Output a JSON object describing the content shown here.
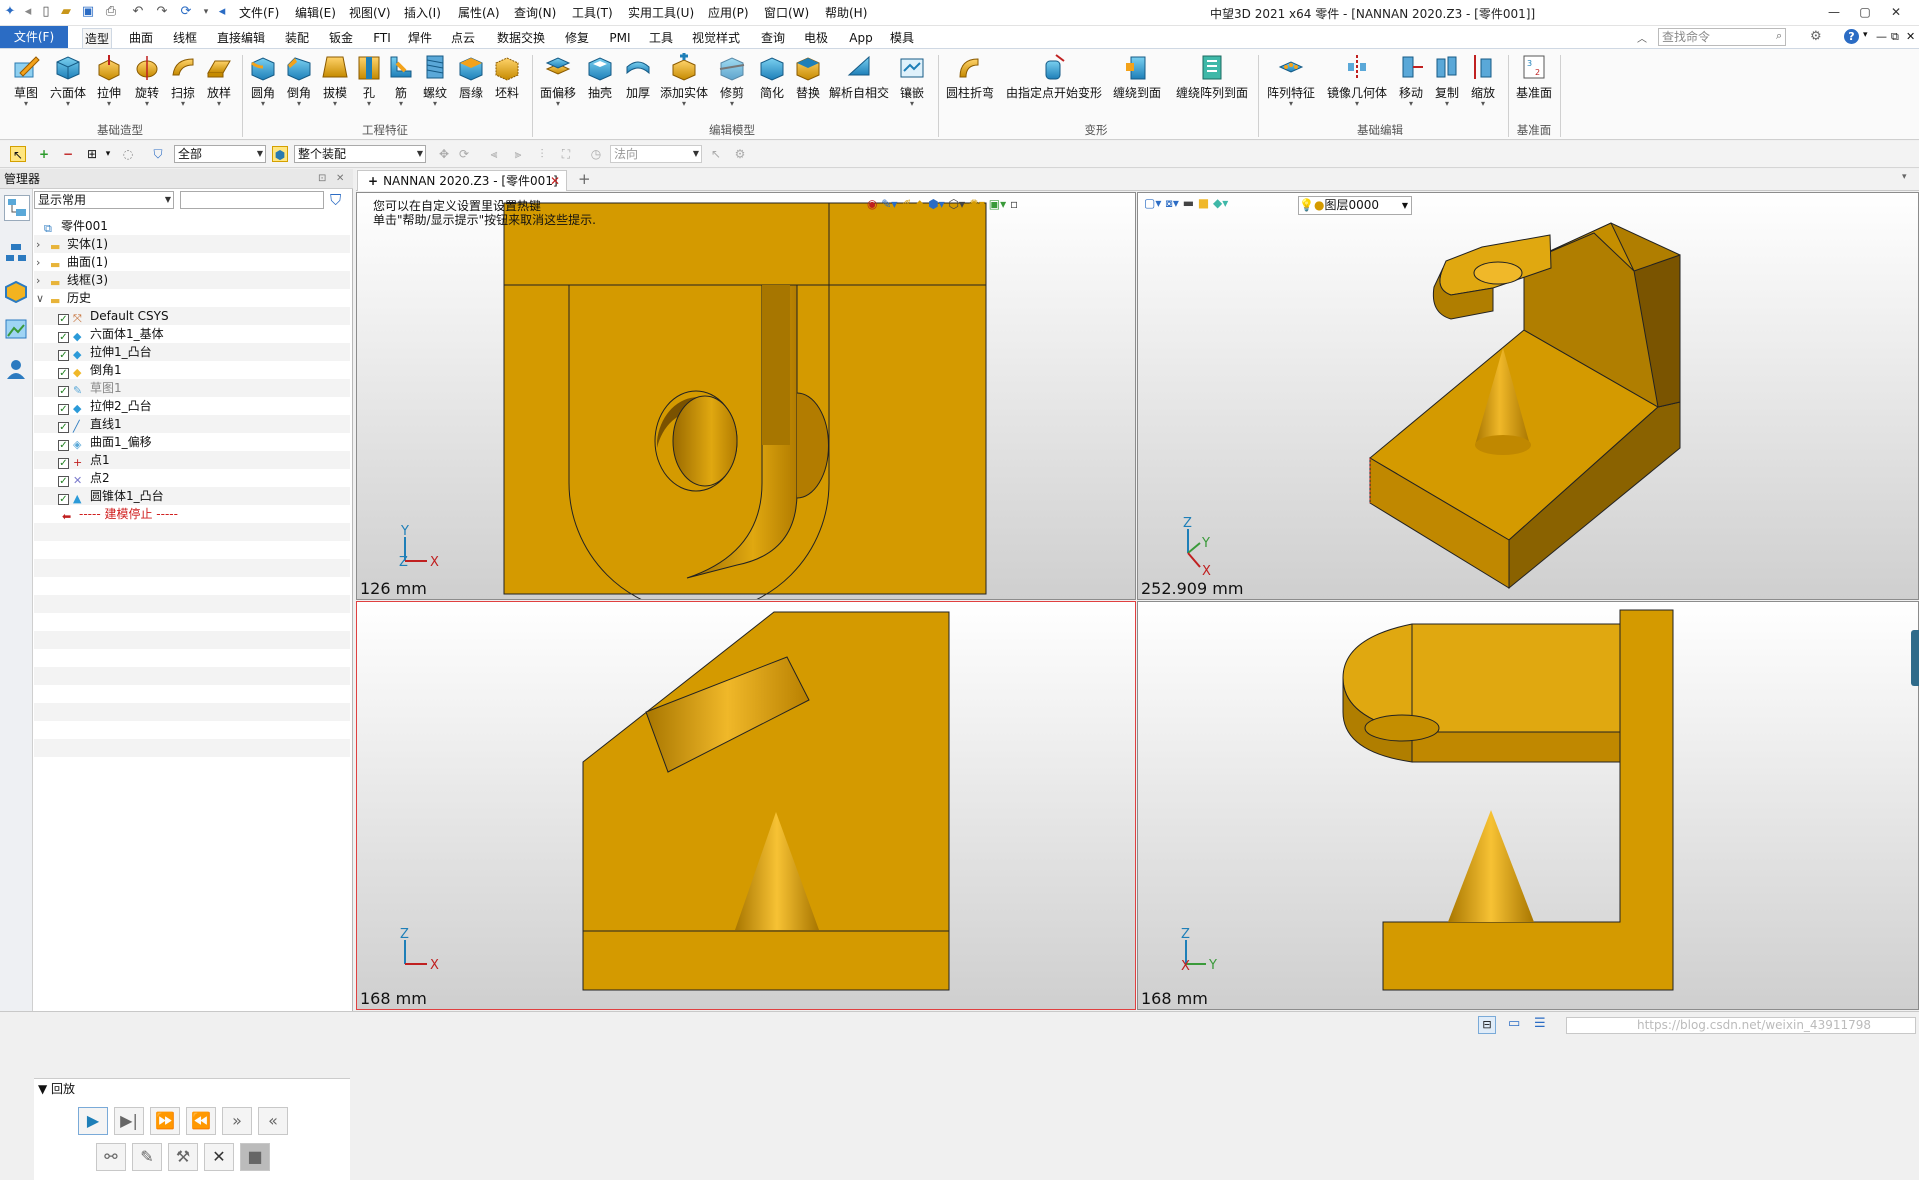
{
  "menus": [
    "文件(F)",
    "编辑(E)",
    "视图(V)",
    "插入(I)",
    "属性(A)",
    "查询(N)",
    "工具(T)",
    "实用工具(U)",
    "应用(P)",
    "窗口(W)",
    "帮助(H)"
  ],
  "window_title": "中望3D 2021 x64      零件 - [NANNAN 2020.Z3 - [零件001]]",
  "ribbon_tabs": [
    "文件(F)",
    "造型",
    "曲面",
    "线框",
    "直接编辑",
    "装配",
    "钣金",
    "FTI",
    "焊件",
    "点云",
    "数据交换",
    "修复",
    "PMI",
    "工具",
    "视觉样式",
    "查询",
    "电极",
    "App",
    "模具"
  ],
  "active_tab": "造型",
  "search_placeholder": "查找命令",
  "ribbon": {
    "groups": {
      "basic": "基础造型",
      "eng": "工程特征",
      "edit": "编辑模型",
      "deform": "变形",
      "basicedit": "基础编辑",
      "datum": "基准面"
    },
    "tools": [
      "草图",
      "六面体",
      "拉伸",
      "旋转",
      "扫掠",
      "放样",
      "圆角",
      "倒角",
      "拔模",
      "孔",
      "筋",
      "螺纹",
      "唇缘",
      "坯料",
      "面偏移",
      "抽壳",
      "加厚",
      "添加实体",
      "修剪",
      "简化",
      "替换",
      "解析自相交",
      "镶嵌",
      "圆柱折弯",
      "由指定点开始变形",
      "缠绕到面",
      "缠绕阵列到面",
      "阵列特征",
      "镜像几何体",
      "移动",
      "复制",
      "缩放",
      "基准面"
    ]
  },
  "toolbar2": {
    "filter_value": "全部",
    "assembly_value": "整个装配",
    "normal_value": "法向"
  },
  "manager": {
    "title": "管理器",
    "display_value": "显示常用",
    "tree": [
      {
        "label": "零件001",
        "indent": 0,
        "icon": "part-icon",
        "check": false,
        "arrow": ""
      },
      {
        "label": "实体(1)",
        "indent": 1,
        "icon": "folder-icon",
        "check": false,
        "arrow": ">"
      },
      {
        "label": "曲面(1)",
        "indent": 1,
        "icon": "folder-icon",
        "check": false,
        "arrow": ">"
      },
      {
        "label": "线框(3)",
        "indent": 1,
        "icon": "folder-icon",
        "check": false,
        "arrow": ">"
      },
      {
        "label": "历史",
        "indent": 1,
        "icon": "folder-icon",
        "check": false,
        "arrow": "v"
      },
      {
        "label": "Default CSYS",
        "indent": 2,
        "icon": "csys-icon",
        "check": true,
        "arrow": ""
      },
      {
        "label": "六面体1_基体",
        "indent": 2,
        "icon": "block-icon",
        "check": true,
        "arrow": ""
      },
      {
        "label": "拉伸1_凸台",
        "indent": 2,
        "icon": "extrude-icon",
        "check": true,
        "arrow": ""
      },
      {
        "label": "倒角1",
        "indent": 2,
        "icon": "chamfer-icon",
        "check": true,
        "arrow": ""
      },
      {
        "label": "草图1",
        "indent": 2,
        "icon": "sketch-icon",
        "check": true,
        "arrow": "",
        "grey": true
      },
      {
        "label": "拉伸2_凸台",
        "indent": 2,
        "icon": "extrude-icon",
        "check": true,
        "arrow": ""
      },
      {
        "label": "直线1",
        "indent": 2,
        "icon": "line-icon",
        "check": true,
        "arrow": ""
      },
      {
        "label": "曲面1_偏移",
        "indent": 2,
        "icon": "surface-icon",
        "check": true,
        "arrow": ""
      },
      {
        "label": "点1",
        "indent": 2,
        "icon": "point-icon",
        "check": true,
        "arrow": ""
      },
      {
        "label": "点2",
        "indent": 2,
        "icon": "point2-icon",
        "check": true,
        "arrow": ""
      },
      {
        "label": "圆锥体1_凸台",
        "indent": 2,
        "icon": "cone-icon",
        "check": true,
        "arrow": ""
      },
      {
        "label": "----- 建模停止 -----",
        "indent": 2,
        "icon": "stop-arrow-icon",
        "check": false,
        "arrow": "",
        "red": true
      }
    ],
    "playback_title": "回放"
  },
  "document_tab": "NANNAN 2020.Z3 - [零件001]",
  "hint": {
    "line1": "您可以在自定义设置里设置热键",
    "line2": "单击\"帮助/显示提示\"按钮来取消这些提示."
  },
  "layer_value": "图层0000",
  "viewports": {
    "front_scale": "126 mm",
    "iso_scale": "252.909 mm",
    "left_scale": "168 mm",
    "right_scale": "168 mm"
  },
  "axis_labels": {
    "x": "X",
    "y": "Y",
    "z": "Z"
  },
  "status_watermark": "https://blog.csdn.net/weixin_43911798",
  "colors": {
    "part": "#d49a00",
    "part_dark": "#8a6200",
    "part_light": "#f0b829",
    "accent": "#2b6cc4",
    "selected_border": "#e04040"
  }
}
